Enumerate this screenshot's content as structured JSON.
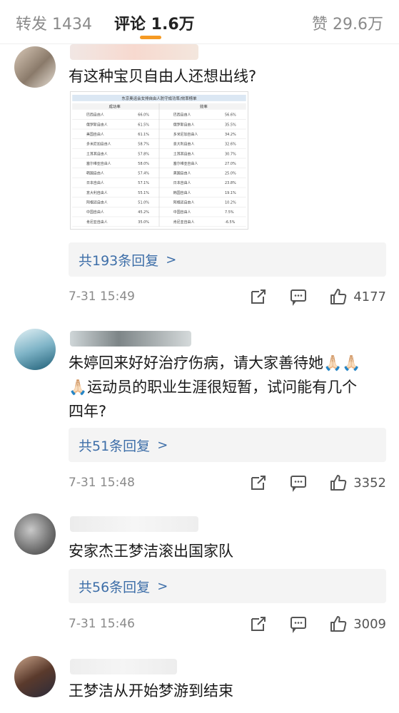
{
  "tabs": {
    "repost": "转发 1434",
    "comment": "评论 1.6万",
    "like": "赞 29.6万"
  },
  "colors": {
    "accent": "#f59a23",
    "reply_link": "#3d6ea8"
  },
  "comments": [
    {
      "text": "有这种宝贝自由人还想出线?",
      "replies": "共193条回复",
      "time": "7-31 15:49",
      "likes": "4177",
      "image": {
        "title": "东京奥运会女排自由人防守成功率/效率榜单",
        "col_left": "成功率",
        "col_right": "效率",
        "rows_left": [
          [
            "巴西自由人",
            "66.0%"
          ],
          [
            "俄罗斯自由人",
            "61.5%"
          ],
          [
            "美国自由人",
            "61.1%"
          ],
          [
            "多米尼加自由人",
            "58.7%"
          ],
          [
            "土耳其自由人",
            "57.8%"
          ],
          [
            "塞尔维亚自由人",
            "58.0%"
          ],
          [
            "韩国自由人",
            "57.4%"
          ],
          [
            "日本自由人",
            "57.1%"
          ],
          [
            "意大利自由人",
            "55.1%"
          ],
          [
            "阿根廷自由人",
            "51.0%"
          ],
          [
            "中国自由人",
            "45.2%"
          ],
          [
            "肯尼亚自由人",
            "35.0%"
          ]
        ],
        "rows_right": [
          [
            "巴西自由人",
            "56.6%"
          ],
          [
            "俄罗斯自由人",
            "35.5%"
          ],
          [
            "多米尼加自由人",
            "34.2%"
          ],
          [
            "意大利自由人",
            "32.6%"
          ],
          [
            "土耳其自由人",
            "30.7%"
          ],
          [
            "塞尔维亚自由人",
            "27.0%"
          ],
          [
            "美国自由人",
            "25.0%"
          ],
          [
            "日本自由人",
            "23.8%"
          ],
          [
            "韩国自由人",
            "19.1%"
          ],
          [
            "阿根廷自由人",
            "10.2%"
          ],
          [
            "中国自由人",
            "7.5%"
          ],
          [
            "肯尼亚自由人",
            "-6.5%"
          ]
        ]
      }
    },
    {
      "text_line1": "朱婷回来好好治疗伤病，请大家善待她🙏🏻🙏🏻",
      "text_line2": "🙏🏻运动员的职业生涯很短暂，试问能有几个",
      "text_line3": "四年?",
      "replies": "共51条回复",
      "time": "7-31 15:48",
      "likes": "3352"
    },
    {
      "text": "安家杰王梦洁滚出国家队",
      "replies": "共56条回复",
      "time": "7-31 15:46",
      "likes": "3009"
    },
    {
      "text": "王梦洁从开始梦游到结束"
    }
  ],
  "reply_chevron": ">",
  "icons": [
    "repost-icon",
    "comment-icon",
    "like-icon"
  ]
}
